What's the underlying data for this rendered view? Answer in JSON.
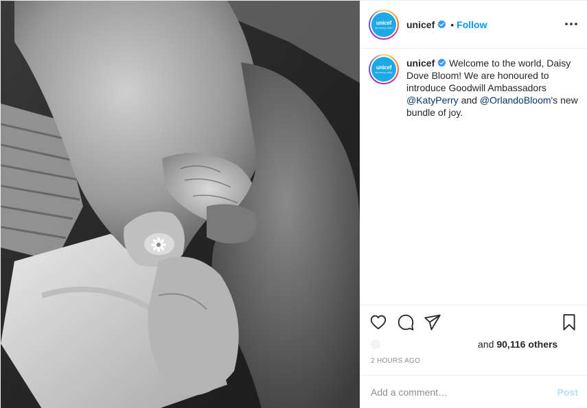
{
  "post": {
    "author": {
      "username": "unicef",
      "avatar_logo_text": "unicef",
      "avatar_logo_subtext": "for every child",
      "verified": true
    },
    "header": {
      "separator": "•",
      "follow_label": "Follow"
    },
    "caption": {
      "username": "unicef",
      "text_part1": " Welcome to the world, Daisy Dove Bloom! We are honoured to introduce Goodwill Ambassadors ",
      "mention1": "@KatyPerry",
      "text_part2": " and ",
      "mention2": "@OrlandoBloom",
      "text_part3": "'s new bundle of joy."
    },
    "likes": {
      "prefix": "and",
      "count": "90,116",
      "suffix": "others"
    },
    "timestamp": "2 HOURS AGO",
    "comment": {
      "placeholder": "Add a comment…",
      "post_label": "Post"
    },
    "icons": {
      "like": "heart-icon",
      "comment": "comment-icon",
      "share": "share-icon",
      "save": "bookmark-icon",
      "more": "more-options-icon",
      "verified": "verified-badge-icon"
    },
    "colors": {
      "accent": "#0095f6",
      "mention": "#00376b",
      "post_disabled": "#b2dffc",
      "muted": "#8e8e8e",
      "unicef_blue": "#1ca9e6"
    }
  }
}
